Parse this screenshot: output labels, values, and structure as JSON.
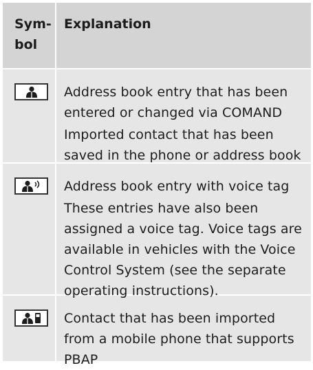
{
  "table": {
    "header": {
      "symbol_line1": "Sym-",
      "symbol_line2": "bol",
      "explanation": "Explanation"
    },
    "rows": [
      {
        "icon": "person-icon",
        "title": "Address book entry that has been entered or changed via COMAND",
        "detail": "Imported contact that has been saved in the phone or address book"
      },
      {
        "icon": "person-voice-icon",
        "title": "Address book entry with voice tag",
        "detail": "These entries have also been assigned a voice tag. Voice tags are available in vehicles with the Voice Control System (see the separate operating instructions)."
      },
      {
        "icon": "person-phone-icon",
        "title": "Contact that has been imported from a mobile phone that supports PBAP",
        "detail": ""
      }
    ]
  }
}
